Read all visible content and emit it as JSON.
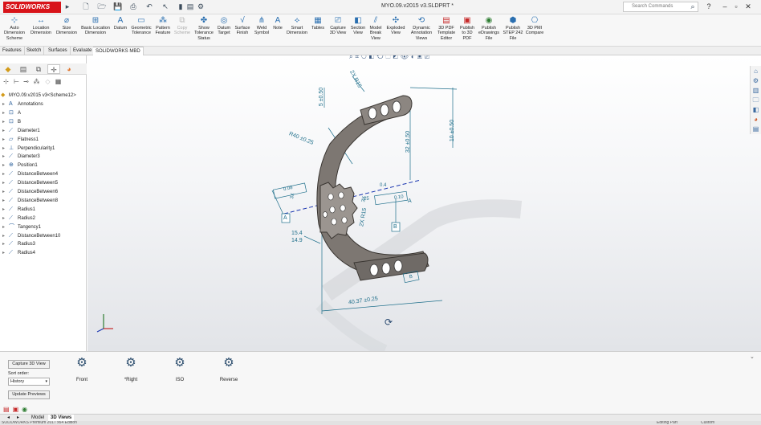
{
  "app": {
    "logo_text": "SOLIDWORKS",
    "document_title": "MYO.09.v2015 v3.SLDPRT *"
  },
  "search": {
    "placeholder": "Search Commands"
  },
  "quick_access_icons": [
    "new-icon",
    "open-icon",
    "save-icon",
    "print-icon",
    "undo-icon",
    "select-icon",
    "rebuild-icon",
    "file-properties-icon",
    "options-icon"
  ],
  "ribbon": [
    {
      "label": "Auto Dimension Scheme",
      "icon": "auto-dimension-icon"
    },
    {
      "label": "Location Dimension",
      "icon": "location-dimension-icon"
    },
    {
      "label": "Size Dimension",
      "icon": "size-dimension-icon"
    },
    {
      "label": "Basic Location Dimension",
      "icon": "basic-location-dimension-icon"
    },
    {
      "label": "Datum",
      "icon": "datum-icon"
    },
    {
      "label": "Geometric Tolerance",
      "icon": "geometric-tolerance-icon"
    },
    {
      "label": "Pattern Feature",
      "icon": "pattern-feature-icon"
    },
    {
      "label": "Copy Scheme",
      "icon": "copy-scheme-icon",
      "disabled": true
    },
    {
      "label": "Show Tolerance Status",
      "icon": "tolerance-status-icon"
    },
    {
      "label": "Datum Target",
      "icon": "datum-target-icon"
    },
    {
      "label": "Surface Finish",
      "icon": "surface-finish-icon"
    },
    {
      "label": "Weld Symbol",
      "icon": "weld-symbol-icon"
    },
    {
      "label": "Note",
      "icon": "note-icon"
    },
    {
      "label": "Smart Dimension",
      "icon": "smart-dimension-icon"
    },
    {
      "label": "Tables",
      "icon": "tables-icon"
    },
    {
      "label": "Capture 3D View",
      "icon": "capture-3d-view-icon"
    },
    {
      "label": "Section View",
      "icon": "section-view-icon"
    },
    {
      "label": "Model Break View",
      "icon": "model-break-view-icon"
    },
    {
      "label": "Exploded View",
      "icon": "exploded-view-icon"
    },
    {
      "label": "Dynamic Annotation Views",
      "icon": "dynamic-annotation-views-icon"
    },
    {
      "label": "3D PDF Template Editor",
      "icon": "pdf-template-editor-icon"
    },
    {
      "label": "Publish to 3D PDF",
      "icon": "publish-3d-pdf-icon"
    },
    {
      "label": "Publish eDrawings File",
      "icon": "publish-edrawings-icon"
    },
    {
      "label": "Publish STEP 242 File",
      "icon": "publish-step-icon"
    },
    {
      "label": "3D PMI Compare",
      "icon": "pmi-compare-icon"
    }
  ],
  "tabs": [
    "Features",
    "Sketch",
    "Surfaces",
    "Evaluate",
    "SOLIDWORKS MBD"
  ],
  "active_tab": "SOLIDWORKS MBD",
  "tree": {
    "root": "MYO.09.v2015 v3<Scheme12>",
    "items": [
      {
        "label": "Annotations",
        "icon": "annotations-icon"
      },
      {
        "label": "A",
        "icon": "datum-icon"
      },
      {
        "label": "B",
        "icon": "datum-icon"
      },
      {
        "label": "Diameter1",
        "icon": "dimension-icon"
      },
      {
        "label": "Flatness1",
        "icon": "flatness-icon"
      },
      {
        "label": "Perpendicularity1",
        "icon": "perpendicularity-icon"
      },
      {
        "label": "Diameter3",
        "icon": "dimension-icon"
      },
      {
        "label": "Position1",
        "icon": "position-icon"
      },
      {
        "label": "DistanceBetween4",
        "icon": "dimension-icon"
      },
      {
        "label": "DistanceBetween5",
        "icon": "dimension-icon"
      },
      {
        "label": "DistanceBetween6",
        "icon": "dimension-icon"
      },
      {
        "label": "DistanceBetween8",
        "icon": "dimension-icon"
      },
      {
        "label": "Radius1",
        "icon": "dimension-icon"
      },
      {
        "label": "Radius2",
        "icon": "dimension-icon"
      },
      {
        "label": "Tangency1",
        "icon": "tangency-icon"
      },
      {
        "label": "DistanceBetween10",
        "icon": "dimension-icon"
      },
      {
        "label": "Radius3",
        "icon": "dimension-icon"
      },
      {
        "label": "Radius4",
        "icon": "dimension-icon"
      }
    ]
  },
  "annotations": {
    "d1": "2X R15",
    "d2": "5 ±0.50",
    "d3": "10 ±0.50",
    "d4": "32 ±0.50",
    "d5": "R40 ±0.25",
    "d6": "0.08",
    "d7": "3X",
    "d8": "0.4",
    "d9": "0.10",
    "d10": "A",
    "d11": "B",
    "d12": "2X R15",
    "d13": "15.4",
    "d14": "14.9",
    "d15": "40.37 ±0.25",
    "d16": "B",
    "d17": "A",
    "d18": "3X",
    "d19": "25",
    "d20": "B"
  },
  "views_panel": {
    "capture_button": "Capture 3D View",
    "sort_label": "Sort order:",
    "sort_value": "History",
    "update_button": "Update Previews",
    "views": [
      {
        "label": "Front",
        "icon": "front-view-icon"
      },
      {
        "label": "*Right",
        "icon": "right-view-icon"
      },
      {
        "label": "ISO",
        "icon": "iso-view-icon"
      },
      {
        "label": "Reverse",
        "icon": "reverse-view-icon"
      }
    ]
  },
  "bottom_tabs": [
    "Model",
    "3D Views"
  ],
  "active_bottom_tab": "3D Views",
  "status": {
    "left": "SOLIDWORKS Premium 2017 x64 Edition",
    "editing": "Editing Part",
    "units": "Custom"
  },
  "colors": {
    "accent": "#2a6fb0",
    "dimension": "#1f6f8b",
    "logo_red": "#d8141a",
    "part": "#8a8480"
  }
}
